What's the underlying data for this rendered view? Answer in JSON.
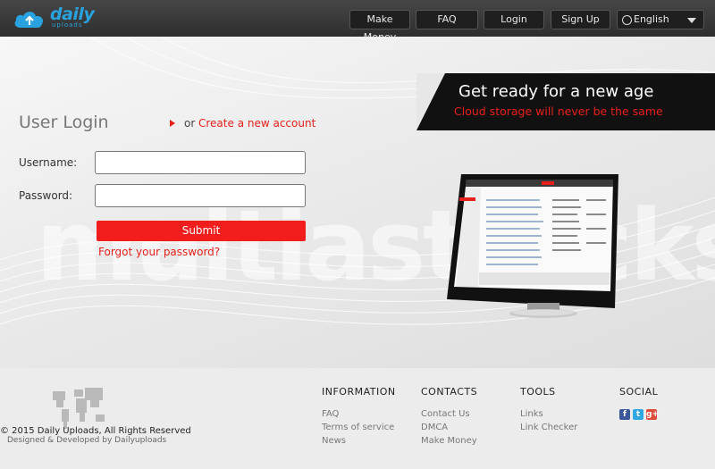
{
  "header": {
    "logo_text": "daily",
    "logo_sub": "uploads",
    "nav": [
      "Make Money",
      "FAQ",
      "Login",
      "Sign Up"
    ],
    "language": "English"
  },
  "banner": {
    "title": "Get ready for a new age",
    "subtitle": "Cloud storage will never be the same"
  },
  "login": {
    "title": "User Login",
    "or_text": "or",
    "create_link": "Create a new account",
    "username_label": "Username:",
    "password_label": "Password:",
    "username_value": "",
    "password_value": "",
    "submit_label": "Submit",
    "forgot_link": "Forgot your password?"
  },
  "watermark": "multiastrocks",
  "footer": {
    "copyright": "© 2015 Daily Uploads, All Rights Reserved",
    "designed_by": "Designed & Developed by Dailyuploads",
    "columns": [
      {
        "title": "INFORMATION",
        "links": [
          "FAQ",
          "Terms of service",
          "News"
        ]
      },
      {
        "title": "CONTACTS",
        "links": [
          "Contact Us",
          "DMCA",
          "Make Money"
        ]
      },
      {
        "title": "TOOLS",
        "links": [
          "Links",
          "Link Checker"
        ]
      },
      {
        "title": "SOCIAL",
        "links": []
      }
    ],
    "social_icons": [
      "facebook-icon",
      "twitter-icon",
      "google-plus-icon"
    ]
  },
  "colors": {
    "accent_red": "#e5201b",
    "brand_blue": "#29a3df",
    "header_bg": "#3c3c3c"
  }
}
